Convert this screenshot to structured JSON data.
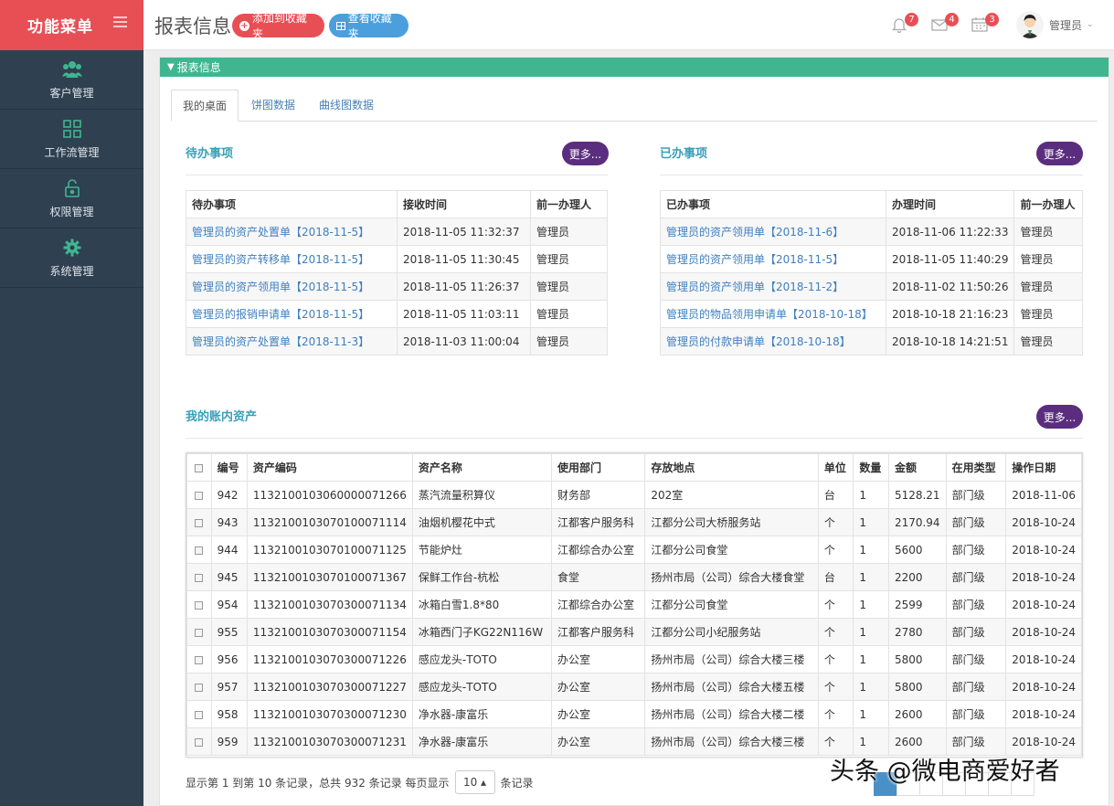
{
  "sidebar": {
    "brand": "功能菜单",
    "items": [
      {
        "label": "客户管理",
        "icon": "users-icon"
      },
      {
        "label": "工作流管理",
        "icon": "grid-icon"
      },
      {
        "label": "权限管理",
        "icon": "lock-icon"
      },
      {
        "label": "系统管理",
        "icon": "gear-icon"
      }
    ]
  },
  "header": {
    "title": "报表信息",
    "add_fav": "添加到收藏夹",
    "view_fav": "查看收藏夹",
    "bell_count": "7",
    "mail_count": "4",
    "calendar_count": "3",
    "user": "管理员"
  },
  "panel": {
    "title": "报表信息",
    "tabs": [
      "我的桌面",
      "饼图数据",
      "曲线图数据"
    ]
  },
  "todo": {
    "title": "待办事项",
    "more": "更多...",
    "headers": [
      "待办事项",
      "接收时间",
      "前一办理人"
    ],
    "rows": [
      [
        "管理员的资产处置单【2018-11-5】",
        "2018-11-05 11:32:37",
        "管理员"
      ],
      [
        "管理员的资产转移单【2018-11-5】",
        "2018-11-05 11:30:45",
        "管理员"
      ],
      [
        "管理员的资产领用单【2018-11-5】",
        "2018-11-05 11:26:37",
        "管理员"
      ],
      [
        "管理员的报销申请单【2018-11-5】",
        "2018-11-05 11:03:11",
        "管理员"
      ],
      [
        "管理员的资产处置单【2018-11-3】",
        "2018-11-03 11:00:04",
        "管理员"
      ]
    ]
  },
  "done": {
    "title": "已办事项",
    "more": "更多...",
    "headers": [
      "已办事项",
      "办理时间",
      "前一办理人"
    ],
    "rows": [
      [
        "管理员的资产领用单【2018-11-6】",
        "2018-11-06 11:22:33",
        "管理员"
      ],
      [
        "管理员的资产领用单【2018-11-5】",
        "2018-11-05 11:40:29",
        "管理员"
      ],
      [
        "管理员的资产领用单【2018-11-2】",
        "2018-11-02 11:50:26",
        "管理员"
      ],
      [
        "管理员的物品领用申请单【2018-10-18】",
        "2018-10-18 21:16:23",
        "管理员"
      ],
      [
        "管理员的付款申请单【2018-10-18】",
        "2018-10-18 14:21:51",
        "管理员"
      ]
    ]
  },
  "assets": {
    "title": "我的账内资产",
    "more": "更多...",
    "headers": [
      "编号",
      "资产编码",
      "资产名称",
      "使用部门",
      "存放地点",
      "单位",
      "数量",
      "金额",
      "在用类型",
      "操作日期"
    ],
    "rows": [
      [
        "942",
        "113210010306000007126​6",
        "蒸汽流量积算仪",
        "财务部",
        "202室",
        "台",
        "1",
        "5128.21",
        "部门级",
        "2018-11-06"
      ],
      [
        "943",
        "113210010307010007111​4",
        "油烟机樱花中式",
        "江都客户服务科",
        "江都分公司大桥服务站",
        "个",
        "1",
        "2170.94",
        "部门级",
        "2018-10-24"
      ],
      [
        "944",
        "113210010307010007112​5",
        "节能炉灶",
        "江都综合办公室",
        "江都分公司食堂",
        "个",
        "1",
        "5600",
        "部门级",
        "2018-10-24"
      ],
      [
        "945",
        "113210010307010007136​7",
        "保鲜工作台-杭松",
        "食堂",
        "扬州市局（公司）综合大楼食堂",
        "台",
        "1",
        "2200",
        "部门级",
        "2018-10-24"
      ],
      [
        "954",
        "113210010307030007113​4",
        "冰箱白雪1.8*80",
        "江都综合办公室",
        "江都分公司食堂",
        "个",
        "1",
        "2599",
        "部门级",
        "2018-10-24"
      ],
      [
        "955",
        "113210010307030007115​4",
        "冰箱西门子KG22N116W",
        "江都客户服务科",
        "江都分公司小纪服务站",
        "个",
        "1",
        "2780",
        "部门级",
        "2018-10-24"
      ],
      [
        "956",
        "113210010307030007122​6",
        "感应龙头-TOTO",
        "办公室",
        "扬州市局（公司）综合大楼三楼",
        "个",
        "1",
        "5800",
        "部门级",
        "2018-10-24"
      ],
      [
        "957",
        "113210010307030007122​7",
        "感应龙头-TOTO",
        "办公室",
        "扬州市局（公司）综合大楼五楼",
        "个",
        "1",
        "5800",
        "部门级",
        "2018-10-24"
      ],
      [
        "958",
        "113210010307030007123​0",
        "净水器-康富乐",
        "办公室",
        "扬州市局（公司）综合大楼二楼",
        "个",
        "1",
        "2600",
        "部门级",
        "2018-10-24"
      ],
      [
        "959",
        "113210010307030007123​1",
        "净水器-康富乐",
        "办公室",
        "扬州市局（公司）综合大楼三楼",
        "个",
        "1",
        "2600",
        "部门级",
        "2018-10-24"
      ]
    ],
    "footer_prefix": "显示第 1 到第 10 条记录，总共 932 条记录 每页显示",
    "page_size": "10 ▴",
    "footer_suffix": "条记录"
  },
  "watermark": "头条 @微电商爱好者",
  "colors": {
    "brand": "#e84f55",
    "sidebar": "#2f4050",
    "panel_head": "#3fb68f",
    "more": "#5b2d7f",
    "link": "#3f7fbf"
  }
}
